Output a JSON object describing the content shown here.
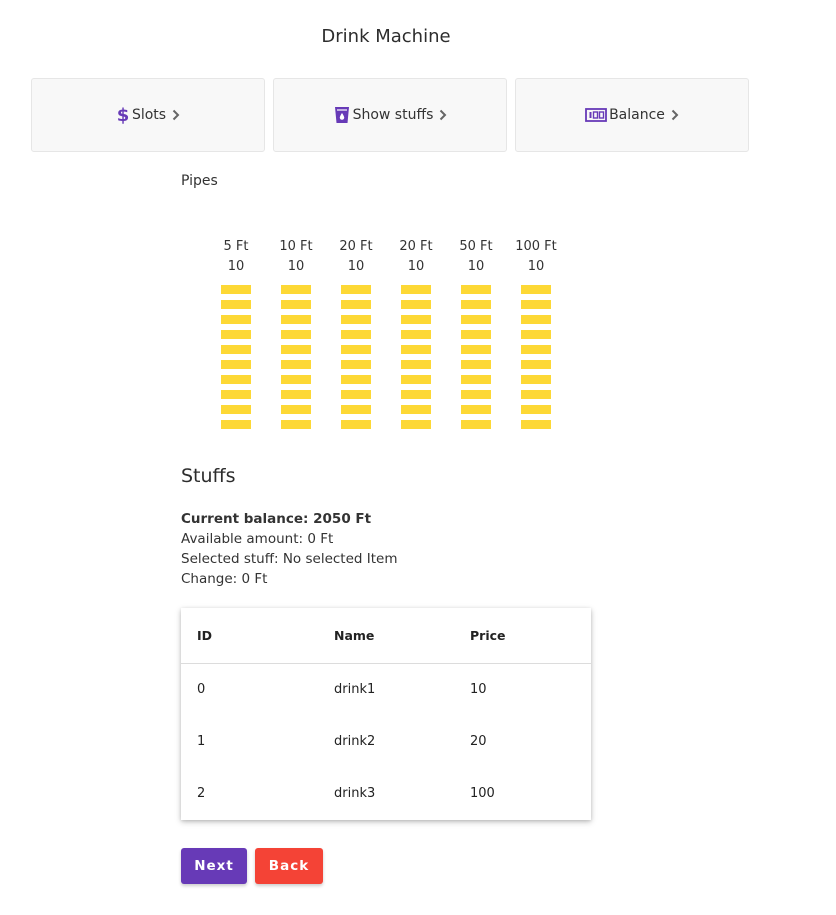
{
  "app": {
    "title": "Drink Machine"
  },
  "nav": [
    {
      "icon": "dollar-icon",
      "label": "Slots"
    },
    {
      "icon": "cup-icon",
      "label": "Show stuffs"
    },
    {
      "icon": "coins-icon",
      "label": "Balance"
    }
  ],
  "pipes": {
    "label": "Pipes",
    "items": [
      {
        "name": "5 Ft",
        "count": "10"
      },
      {
        "name": "10 Ft",
        "count": "10"
      },
      {
        "name": "20 Ft",
        "count": "10"
      },
      {
        "name": "20 Ft",
        "count": "10"
      },
      {
        "name": "50 Ft",
        "count": "10"
      },
      {
        "name": "100 Ft",
        "count": "10"
      }
    ]
  },
  "stuffs": {
    "heading": "Stuffs",
    "current_balance": "Current balance: 2050 Ft",
    "available_amount": "Available amount: 0 Ft",
    "selected_stuff": "Selected stuff: No selected Item",
    "change": "Change: 0 Ft"
  },
  "table": {
    "headers": [
      "ID",
      "Name",
      "Price"
    ],
    "rows": [
      [
        "0",
        "drink1",
        "10"
      ],
      [
        "1",
        "drink2",
        "20"
      ],
      [
        "2",
        "drink3",
        "100"
      ]
    ]
  },
  "buttons": {
    "next": "Next",
    "back": "Back"
  },
  "colors": {
    "accent": "#673ab7",
    "danger": "#f44336",
    "coin": "#fdd835"
  }
}
